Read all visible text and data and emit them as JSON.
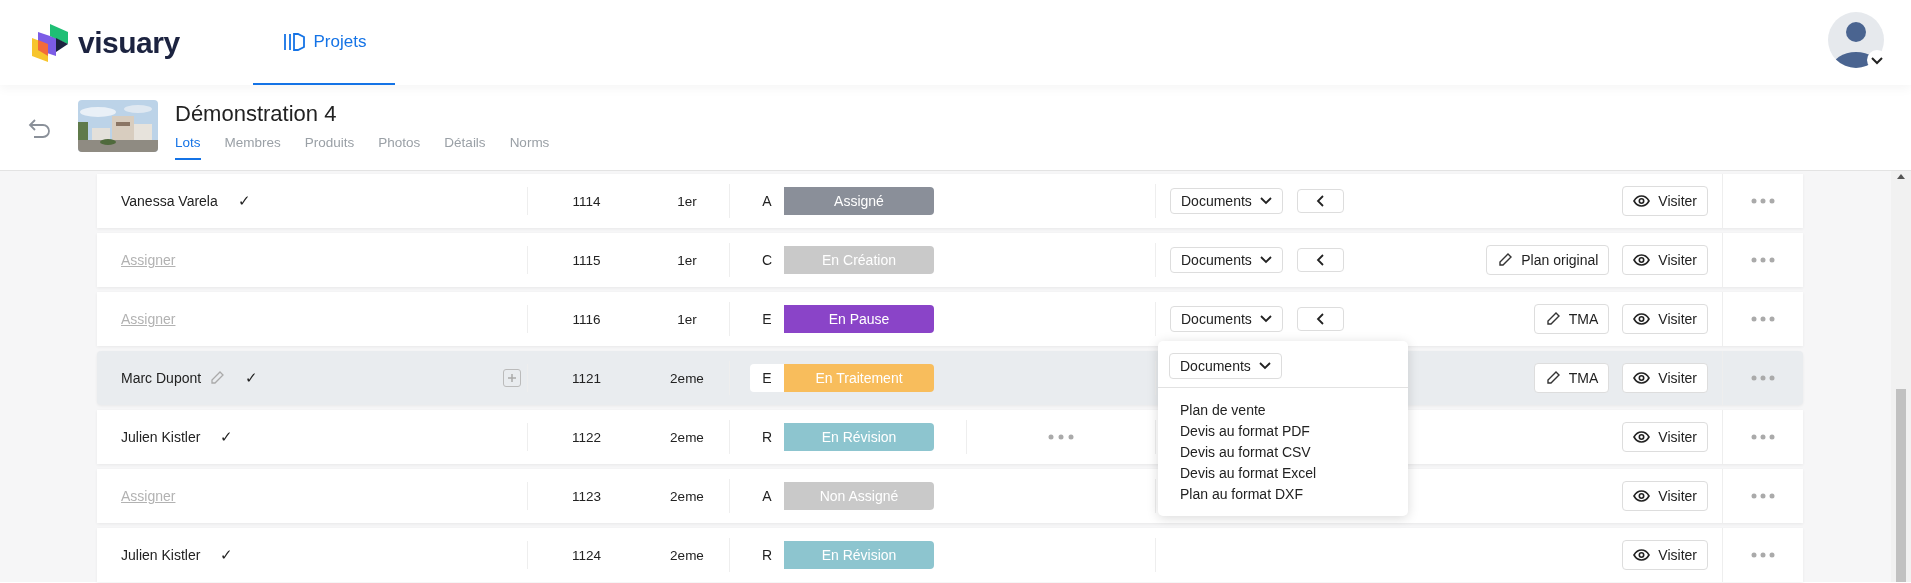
{
  "header": {
    "logo": "visuary",
    "nav": [
      {
        "label": "Projets",
        "selected": true
      }
    ]
  },
  "project": {
    "title": "Démonstration 4",
    "tabs": [
      {
        "label": "Lots",
        "selected": true
      },
      {
        "label": "Membres",
        "selected": false
      },
      {
        "label": "Produits",
        "selected": false
      },
      {
        "label": "Photos",
        "selected": false
      },
      {
        "label": "Détails",
        "selected": false
      },
      {
        "label": "Norms",
        "selected": false
      }
    ]
  },
  "rows": [
    {
      "kind": "person",
      "name": "Vanessa Varela",
      "check": "✓",
      "editable": false,
      "has_extra": false,
      "selected": false,
      "number": "1114",
      "floor": "1er",
      "letter": "A",
      "status": "Assigné",
      "color": "#8a8f99",
      "documents": "Documents",
      "action": "",
      "visit": "Visiter"
    },
    {
      "kind": "unassigned",
      "name": "Assigner",
      "editable": false,
      "has_extra": false,
      "selected": false,
      "number": "1115",
      "floor": "1er",
      "letter": "C",
      "status": "En Création",
      "color": "#c9c9c9",
      "documents": "Documents",
      "action": "Plan original",
      "visit": "Visiter"
    },
    {
      "kind": "unassigned",
      "name": "Assigner",
      "editable": false,
      "has_extra": false,
      "selected": false,
      "number": "1116",
      "floor": "1er",
      "letter": "E",
      "status": "En Pause",
      "color": "#8a44c8",
      "documents": "Documents",
      "action": "TMA",
      "visit": "Visiter"
    },
    {
      "kind": "person",
      "name": "Marc Dupont",
      "check": "✓",
      "editable": true,
      "has_extra": false,
      "selected": true,
      "number": "1121",
      "floor": "2eme",
      "letter": "E",
      "status": "En Traitement",
      "color": "#f8bd5c",
      "action": "TMA",
      "visit": "Visiter"
    },
    {
      "kind": "person",
      "name": "Julien Kistler",
      "check": "✓",
      "editable": false,
      "has_extra": true,
      "selected": false,
      "number": "1122",
      "floor": "2eme",
      "letter": "R",
      "status": "En Révision",
      "color": "#8dc5cf",
      "visit": "Visiter"
    },
    {
      "kind": "unassigned",
      "name": "Assigner",
      "editable": false,
      "has_extra": false,
      "selected": false,
      "number": "1123",
      "floor": "2eme",
      "letter": "A",
      "status": "Non Assigné",
      "color": "#c9c9c9",
      "visit": "Visiter"
    },
    {
      "kind": "person",
      "name": "Julien Kistler",
      "check": "✓",
      "editable": false,
      "has_extra": false,
      "selected": false,
      "number": "1124",
      "floor": "2eme",
      "letter": "R",
      "status": "En Révision",
      "color": "#8dc5cf",
      "visit": "Visiter"
    }
  ],
  "dropdown": {
    "button": "Documents",
    "items": [
      "Plan de vente",
      "Devis au format PDF",
      "Devis au format CSV",
      "Devis au format Excel",
      "Plan au format DXF"
    ]
  }
}
